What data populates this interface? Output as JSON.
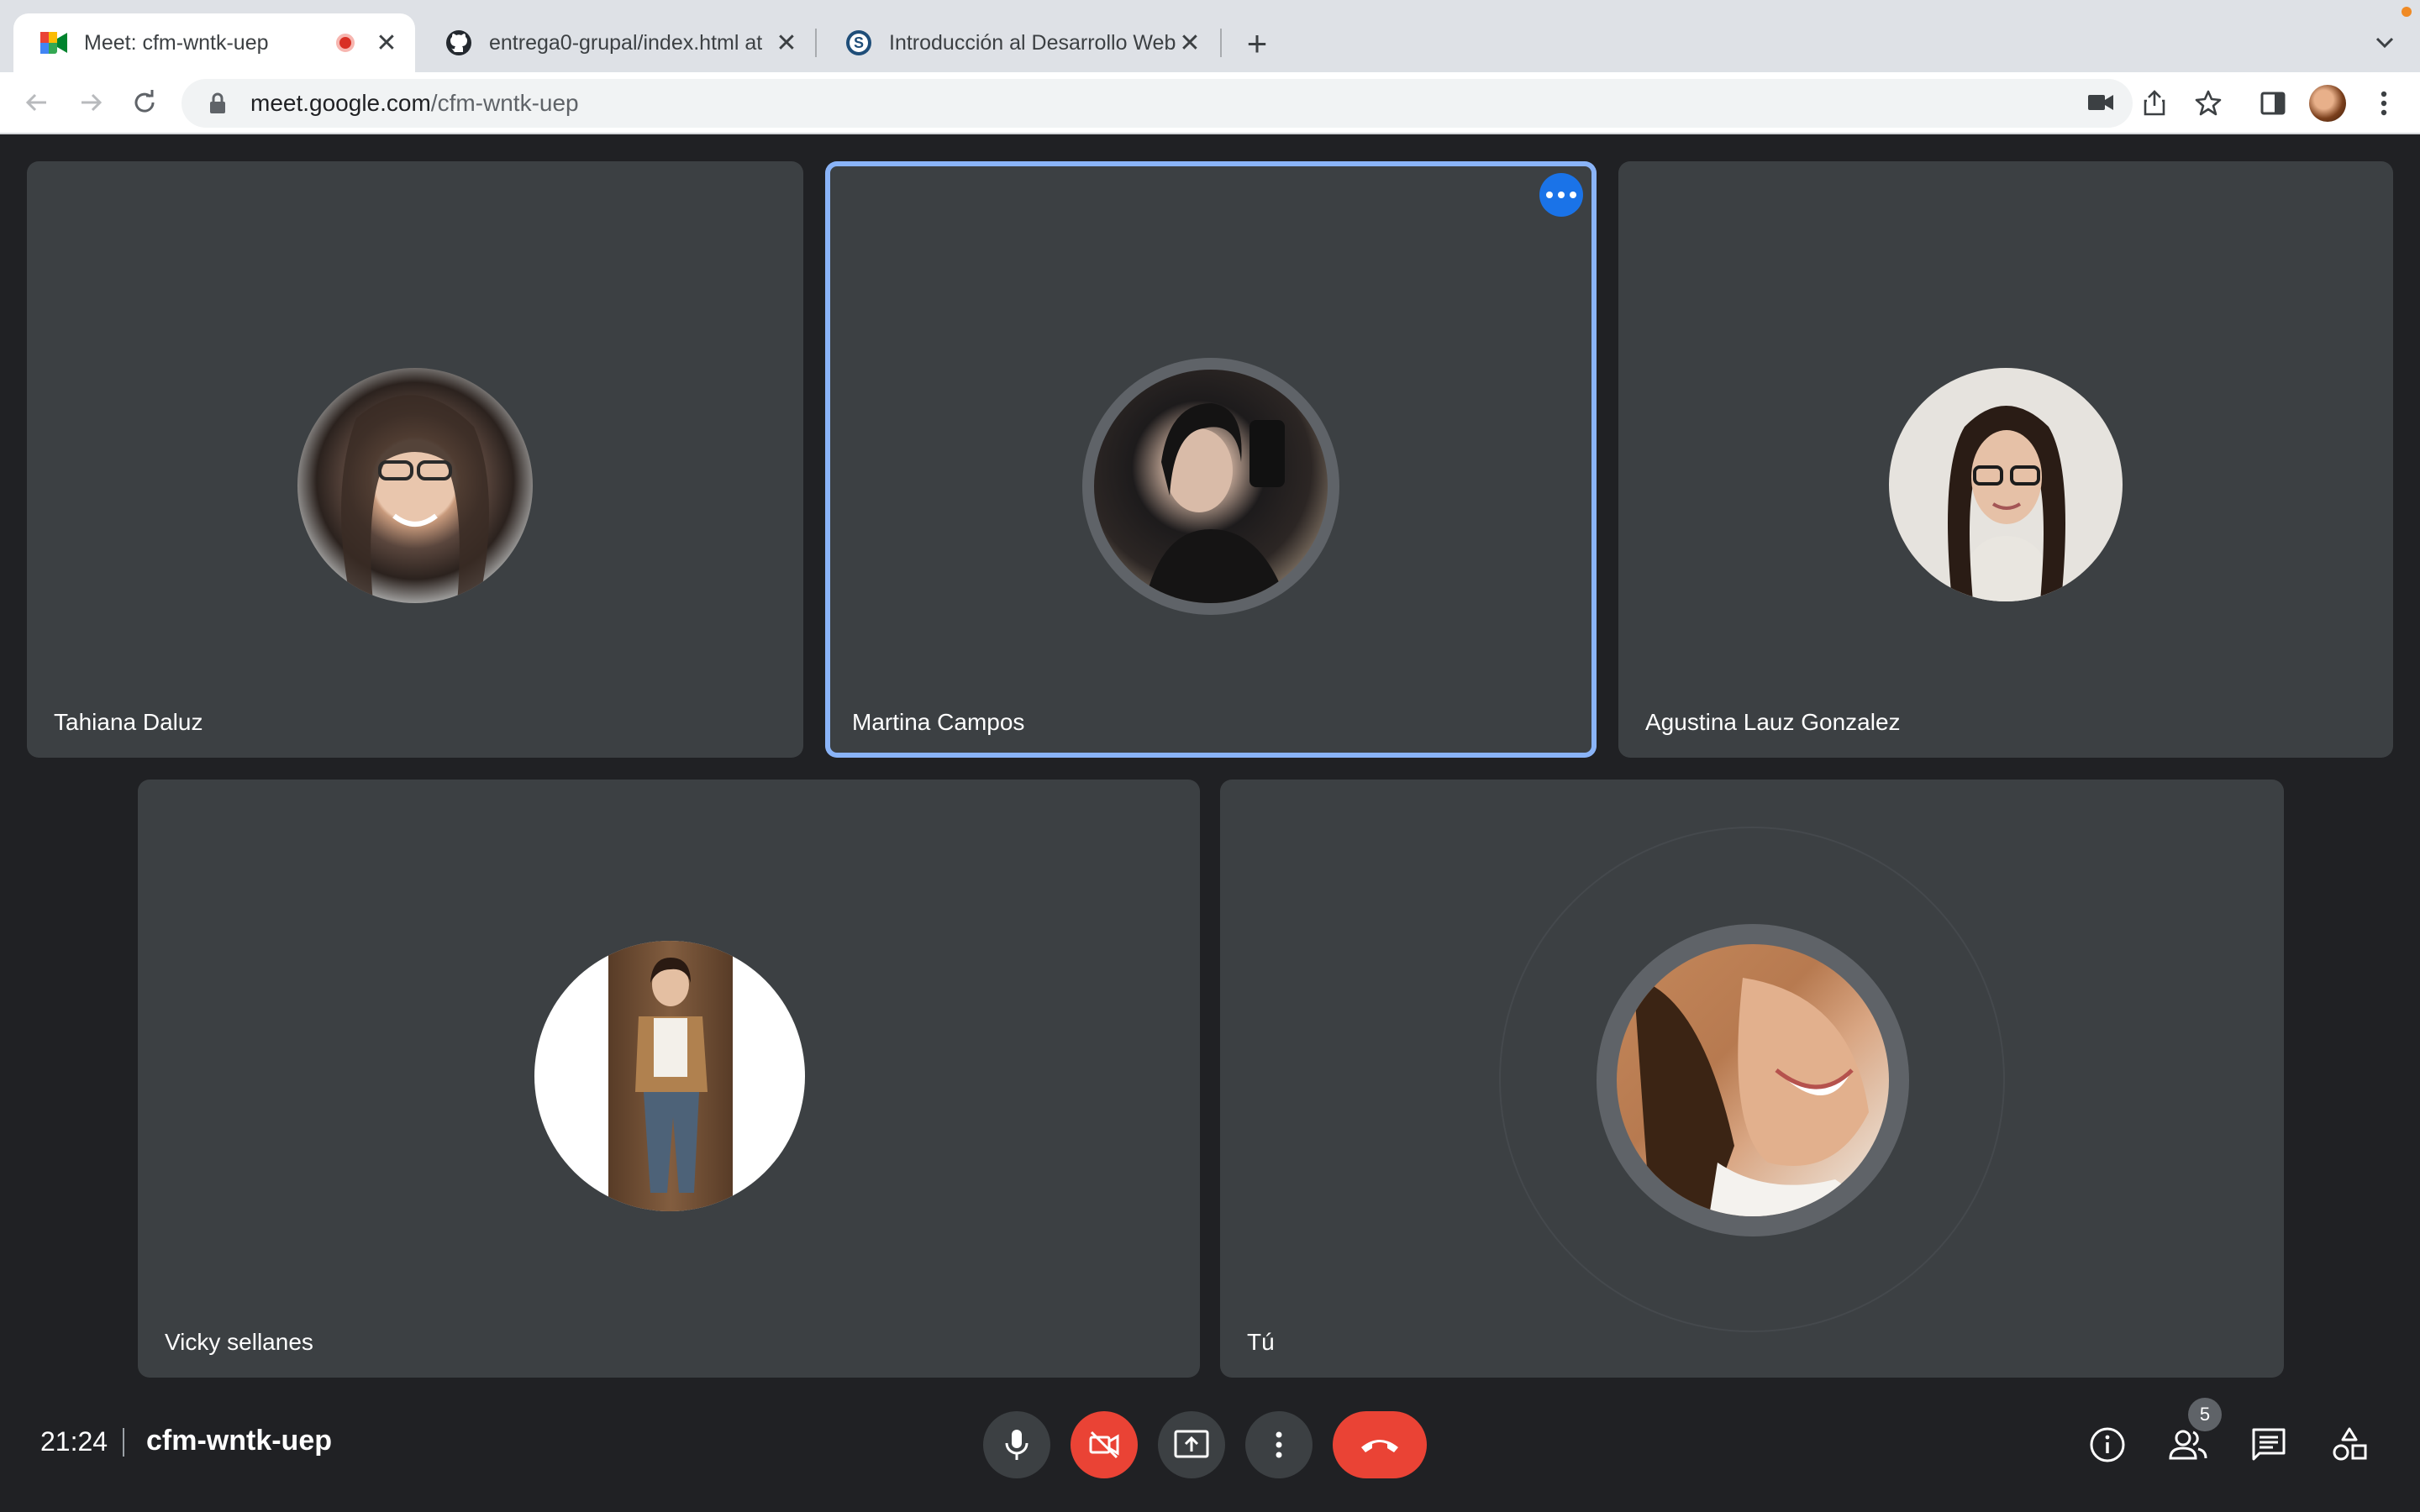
{
  "browser": {
    "tabs": [
      {
        "title": "Meet: cfm-wntk-uep",
        "favicon": "google-meet-icon",
        "recording": true,
        "active": true
      },
      {
        "title": "entrega0-grupal/index.html at",
        "favicon": "github-icon",
        "active": false
      },
      {
        "title": "Introducción al Desarrollo Web",
        "favicon": "site-s-icon",
        "active": false
      }
    ],
    "url_host": "meet.google.com",
    "url_path": "/cfm-wntk-uep"
  },
  "meeting": {
    "participants": [
      {
        "name": "Tahiana Daluz",
        "speaking": false
      },
      {
        "name": "Martina Campos",
        "speaking": true
      },
      {
        "name": "Agustina Lauz Gonzalez",
        "speaking": false
      },
      {
        "name": "Vicky sellanes",
        "speaking": false
      },
      {
        "name": "Tú",
        "speaking": false
      }
    ],
    "time": "21:24",
    "code": "cfm-wntk-uep",
    "participant_count": "5"
  },
  "colors": {
    "tile_bg": "#3c4043",
    "stage_bg": "#202124",
    "speaking_border": "#8ab4f8",
    "hangup_red": "#ea4335",
    "accent_blue": "#1a73e8"
  }
}
